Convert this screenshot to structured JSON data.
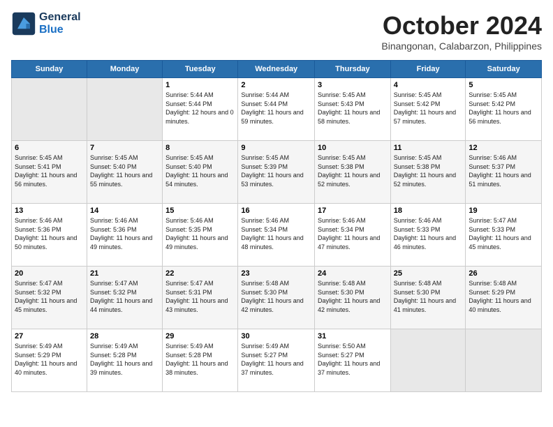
{
  "header": {
    "logo_line1": "General",
    "logo_line2": "Blue",
    "month": "October 2024",
    "location": "Binangonan, Calabarzon, Philippines"
  },
  "days_of_week": [
    "Sunday",
    "Monday",
    "Tuesday",
    "Wednesday",
    "Thursday",
    "Friday",
    "Saturday"
  ],
  "weeks": [
    [
      {
        "day": "",
        "empty": true
      },
      {
        "day": "",
        "empty": true
      },
      {
        "day": "1",
        "sunrise": "Sunrise: 5:44 AM",
        "sunset": "Sunset: 5:44 PM",
        "daylight": "Daylight: 12 hours and 0 minutes."
      },
      {
        "day": "2",
        "sunrise": "Sunrise: 5:44 AM",
        "sunset": "Sunset: 5:44 PM",
        "daylight": "Daylight: 11 hours and 59 minutes."
      },
      {
        "day": "3",
        "sunrise": "Sunrise: 5:45 AM",
        "sunset": "Sunset: 5:43 PM",
        "daylight": "Daylight: 11 hours and 58 minutes."
      },
      {
        "day": "4",
        "sunrise": "Sunrise: 5:45 AM",
        "sunset": "Sunset: 5:42 PM",
        "daylight": "Daylight: 11 hours and 57 minutes."
      },
      {
        "day": "5",
        "sunrise": "Sunrise: 5:45 AM",
        "sunset": "Sunset: 5:42 PM",
        "daylight": "Daylight: 11 hours and 56 minutes."
      }
    ],
    [
      {
        "day": "6",
        "sunrise": "Sunrise: 5:45 AM",
        "sunset": "Sunset: 5:41 PM",
        "daylight": "Daylight: 11 hours and 56 minutes."
      },
      {
        "day": "7",
        "sunrise": "Sunrise: 5:45 AM",
        "sunset": "Sunset: 5:40 PM",
        "daylight": "Daylight: 11 hours and 55 minutes."
      },
      {
        "day": "8",
        "sunrise": "Sunrise: 5:45 AM",
        "sunset": "Sunset: 5:40 PM",
        "daylight": "Daylight: 11 hours and 54 minutes."
      },
      {
        "day": "9",
        "sunrise": "Sunrise: 5:45 AM",
        "sunset": "Sunset: 5:39 PM",
        "daylight": "Daylight: 11 hours and 53 minutes."
      },
      {
        "day": "10",
        "sunrise": "Sunrise: 5:45 AM",
        "sunset": "Sunset: 5:38 PM",
        "daylight": "Daylight: 11 hours and 52 minutes."
      },
      {
        "day": "11",
        "sunrise": "Sunrise: 5:45 AM",
        "sunset": "Sunset: 5:38 PM",
        "daylight": "Daylight: 11 hours and 52 minutes."
      },
      {
        "day": "12",
        "sunrise": "Sunrise: 5:46 AM",
        "sunset": "Sunset: 5:37 PM",
        "daylight": "Daylight: 11 hours and 51 minutes."
      }
    ],
    [
      {
        "day": "13",
        "sunrise": "Sunrise: 5:46 AM",
        "sunset": "Sunset: 5:36 PM",
        "daylight": "Daylight: 11 hours and 50 minutes."
      },
      {
        "day": "14",
        "sunrise": "Sunrise: 5:46 AM",
        "sunset": "Sunset: 5:36 PM",
        "daylight": "Daylight: 11 hours and 49 minutes."
      },
      {
        "day": "15",
        "sunrise": "Sunrise: 5:46 AM",
        "sunset": "Sunset: 5:35 PM",
        "daylight": "Daylight: 11 hours and 49 minutes."
      },
      {
        "day": "16",
        "sunrise": "Sunrise: 5:46 AM",
        "sunset": "Sunset: 5:34 PM",
        "daylight": "Daylight: 11 hours and 48 minutes."
      },
      {
        "day": "17",
        "sunrise": "Sunrise: 5:46 AM",
        "sunset": "Sunset: 5:34 PM",
        "daylight": "Daylight: 11 hours and 47 minutes."
      },
      {
        "day": "18",
        "sunrise": "Sunrise: 5:46 AM",
        "sunset": "Sunset: 5:33 PM",
        "daylight": "Daylight: 11 hours and 46 minutes."
      },
      {
        "day": "19",
        "sunrise": "Sunrise: 5:47 AM",
        "sunset": "Sunset: 5:33 PM",
        "daylight": "Daylight: 11 hours and 45 minutes."
      }
    ],
    [
      {
        "day": "20",
        "sunrise": "Sunrise: 5:47 AM",
        "sunset": "Sunset: 5:32 PM",
        "daylight": "Daylight: 11 hours and 45 minutes."
      },
      {
        "day": "21",
        "sunrise": "Sunrise: 5:47 AM",
        "sunset": "Sunset: 5:32 PM",
        "daylight": "Daylight: 11 hours and 44 minutes."
      },
      {
        "day": "22",
        "sunrise": "Sunrise: 5:47 AM",
        "sunset": "Sunset: 5:31 PM",
        "daylight": "Daylight: 11 hours and 43 minutes."
      },
      {
        "day": "23",
        "sunrise": "Sunrise: 5:48 AM",
        "sunset": "Sunset: 5:30 PM",
        "daylight": "Daylight: 11 hours and 42 minutes."
      },
      {
        "day": "24",
        "sunrise": "Sunrise: 5:48 AM",
        "sunset": "Sunset: 5:30 PM",
        "daylight": "Daylight: 11 hours and 42 minutes."
      },
      {
        "day": "25",
        "sunrise": "Sunrise: 5:48 AM",
        "sunset": "Sunset: 5:30 PM",
        "daylight": "Daylight: 11 hours and 41 minutes."
      },
      {
        "day": "26",
        "sunrise": "Sunrise: 5:48 AM",
        "sunset": "Sunset: 5:29 PM",
        "daylight": "Daylight: 11 hours and 40 minutes."
      }
    ],
    [
      {
        "day": "27",
        "sunrise": "Sunrise: 5:49 AM",
        "sunset": "Sunset: 5:29 PM",
        "daylight": "Daylight: 11 hours and 40 minutes."
      },
      {
        "day": "28",
        "sunrise": "Sunrise: 5:49 AM",
        "sunset": "Sunset: 5:28 PM",
        "daylight": "Daylight: 11 hours and 39 minutes."
      },
      {
        "day": "29",
        "sunrise": "Sunrise: 5:49 AM",
        "sunset": "Sunset: 5:28 PM",
        "daylight": "Daylight: 11 hours and 38 minutes."
      },
      {
        "day": "30",
        "sunrise": "Sunrise: 5:49 AM",
        "sunset": "Sunset: 5:27 PM",
        "daylight": "Daylight: 11 hours and 37 minutes."
      },
      {
        "day": "31",
        "sunrise": "Sunrise: 5:50 AM",
        "sunset": "Sunset: 5:27 PM",
        "daylight": "Daylight: 11 hours and 37 minutes."
      },
      {
        "day": "",
        "empty": true
      },
      {
        "day": "",
        "empty": true
      }
    ]
  ]
}
